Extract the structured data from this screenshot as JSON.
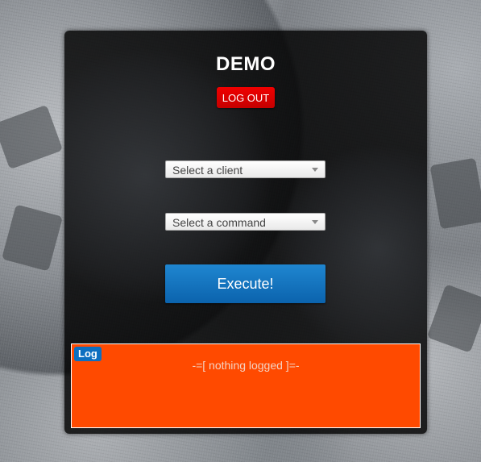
{
  "app": {
    "title": "DEMO"
  },
  "header": {
    "logout_label": "LOG OUT"
  },
  "form": {
    "client_select": {
      "selected": "Select a client"
    },
    "command_select": {
      "selected": "Select a command"
    },
    "execute_label": "Execute!"
  },
  "log": {
    "tag": "Log",
    "message": "-=[ nothing logged ]=-"
  },
  "colors": {
    "logout": "#e00000",
    "execute": "#1674c0",
    "log_background": "#ff4a00",
    "log_tag": "#0d6fc0"
  },
  "icons": {
    "select_arrow": "chevron-down-icon"
  }
}
